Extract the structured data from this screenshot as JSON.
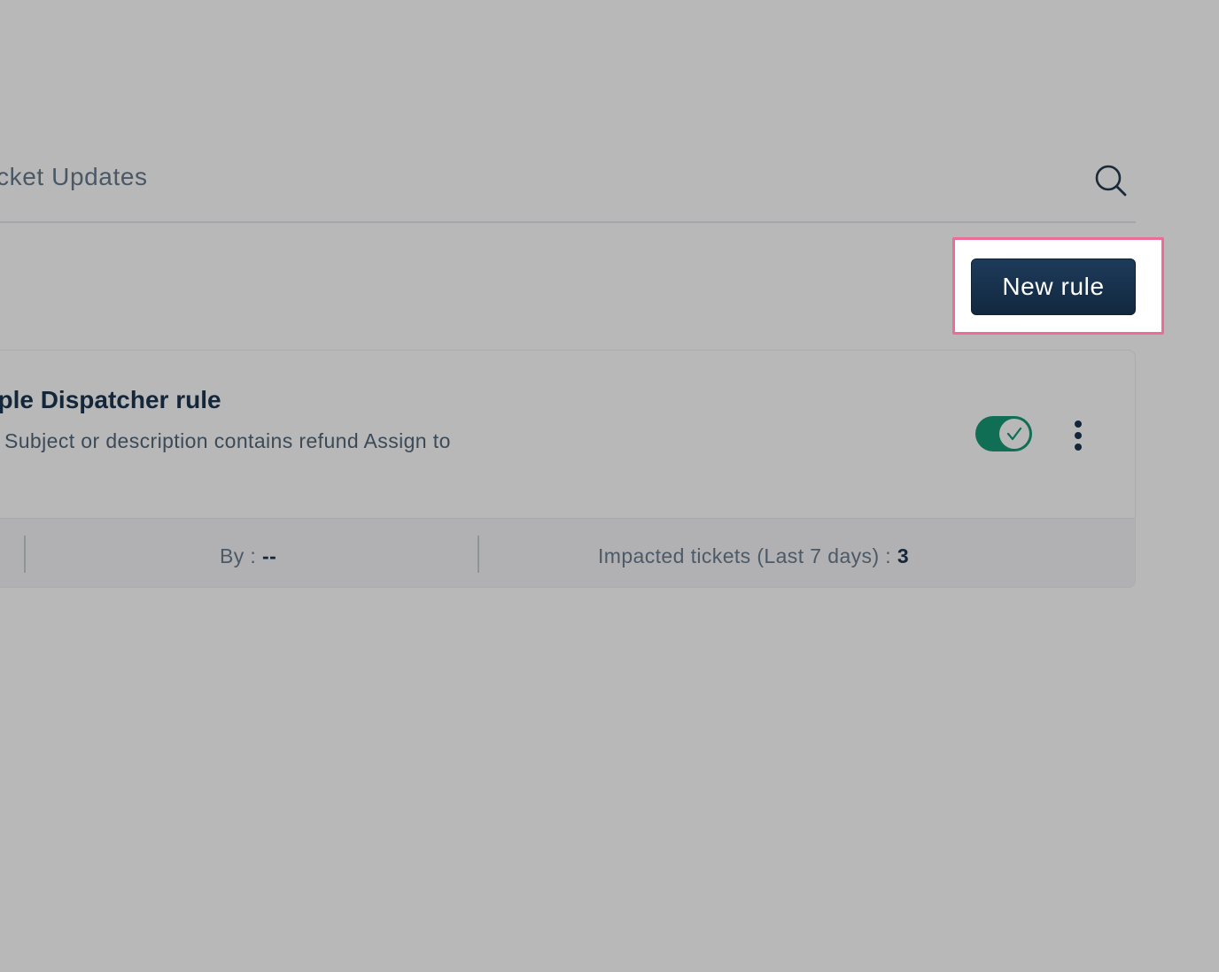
{
  "header": {
    "tab_label": "cket Updates",
    "search_icon": "search-icon"
  },
  "toolbar": {
    "new_rule_label": "New rule",
    "highlight_color": "#ee6b97"
  },
  "rule": {
    "title": "ample Dispatcher rule",
    "description": "Subject or description contains refund Assign to",
    "enabled": true,
    "toggle_color": "#106e55",
    "menu_icon": "more-vertical-icon",
    "footer": {
      "by_label": "By : ",
      "by_value": "--",
      "impacted_label": "Impacted tickets (Last 7 days) : ",
      "impacted_value": "3"
    }
  }
}
